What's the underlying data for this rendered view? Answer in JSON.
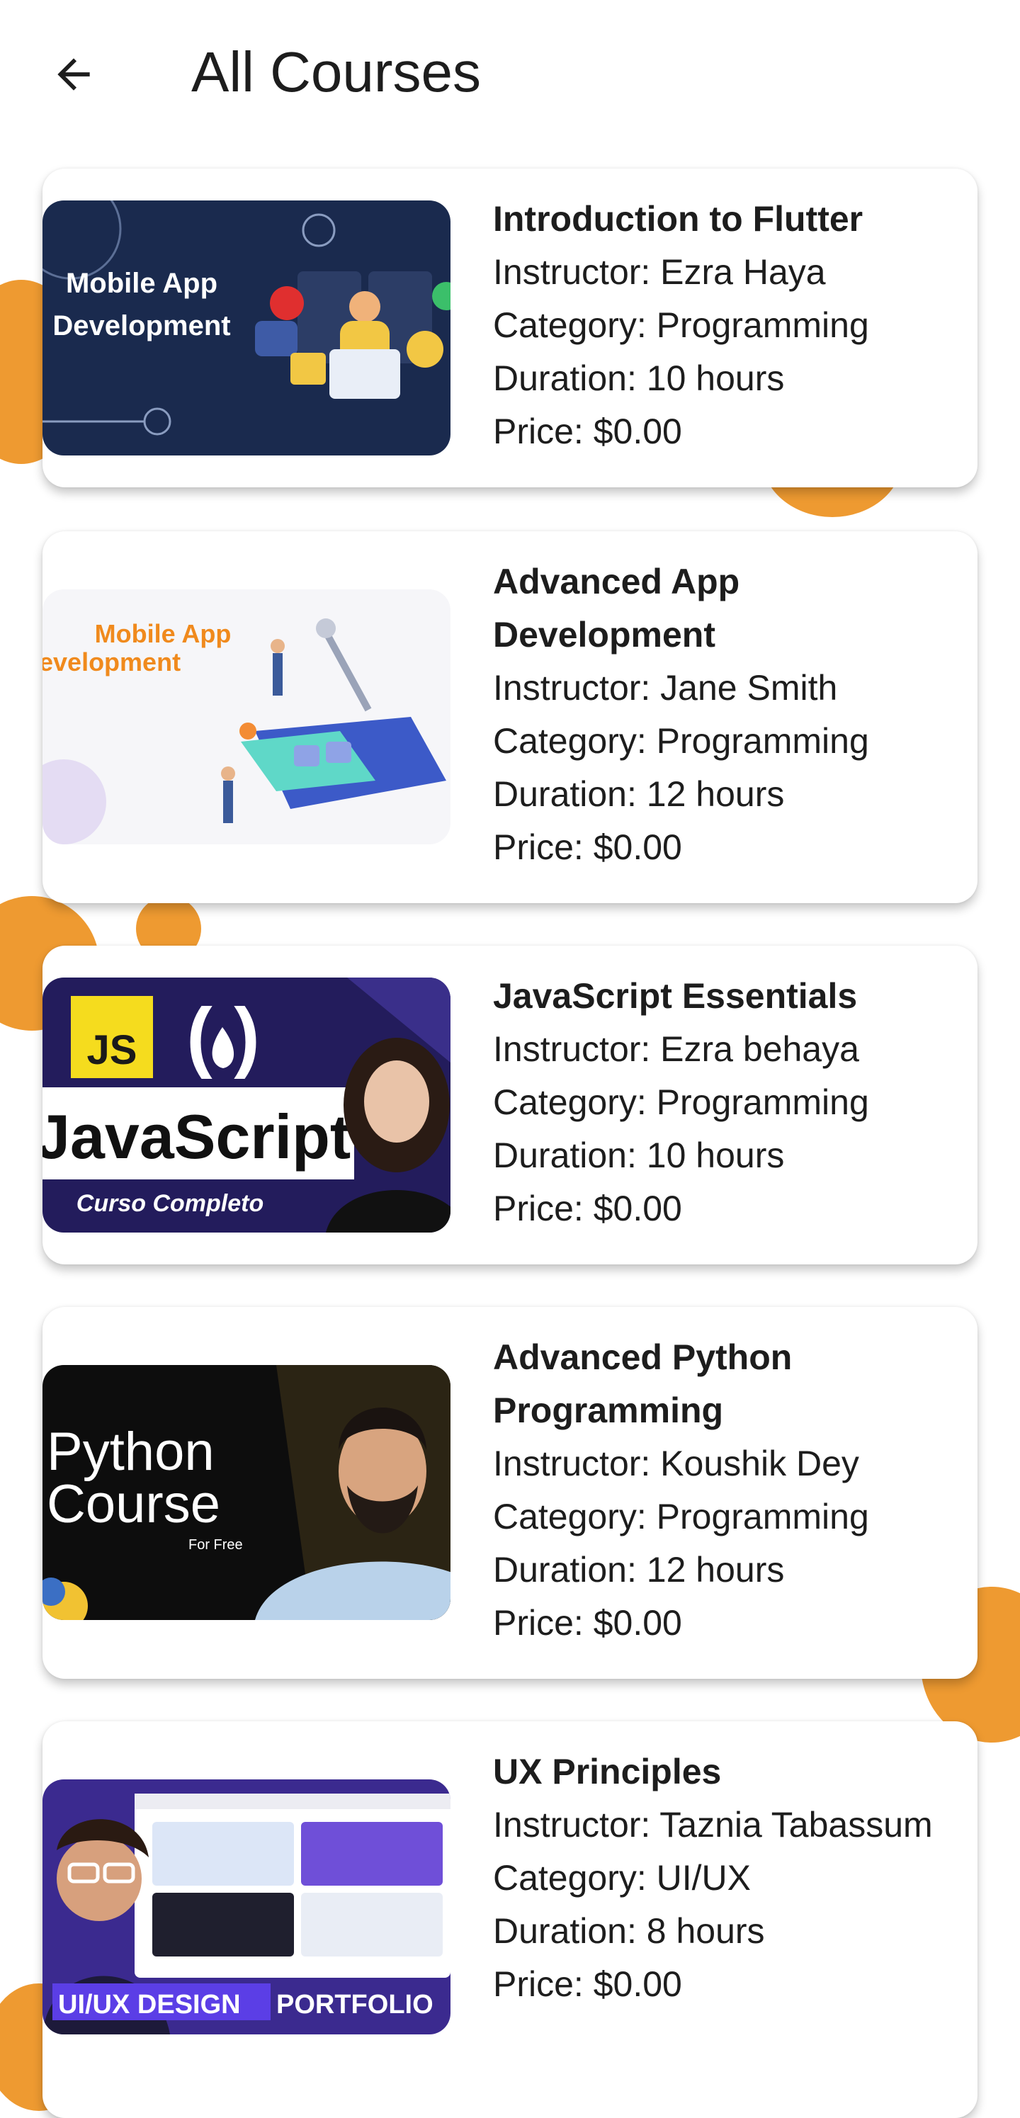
{
  "appbar": {
    "title": "All Courses",
    "back_icon": "arrow-left-icon"
  },
  "courses": [
    {
      "title": "Introduction to Flutter",
      "instructor": "Instructor: Ezra Haya",
      "category": "Category: Programming",
      "duration": "Duration: 10 hours",
      "price": "Price: $0.00",
      "thumb_text": [
        "Mobile App",
        "Development"
      ]
    },
    {
      "title": "Advanced App Development",
      "instructor": "Instructor: Jane Smith",
      "category": "Category: Programming",
      "duration": "Duration: 12 hours",
      "price": "Price: $0.00",
      "thumb_text": [
        "Mobile App",
        "evelopment"
      ]
    },
    {
      "title": "JavaScript Essentials",
      "instructor": "Instructor: Ezra behaya",
      "category": "Category: Programming",
      "duration": "Duration: 10 hours",
      "price": "Price: $0.00",
      "thumb_text": [
        "JS",
        "JavaScript",
        "Curso Completo"
      ]
    },
    {
      "title": "Advanced Python Programming",
      "instructor": "Instructor: Koushik Dey",
      "category": "Category: Programming",
      "duration": "Duration: 12 hours",
      "price": "Price: $0.00",
      "thumb_text": [
        "Python",
        "Course",
        "For Free"
      ]
    },
    {
      "title": "UX Principles",
      "instructor": "Instructor: Taznia Tabassum",
      "category": "Category: UI/UX",
      "duration": "Duration: 8 hours",
      "price": "Price: $0.00",
      "thumb_text": [
        "UI/UX DESIGN",
        "PORTFOLIO"
      ]
    }
  ],
  "colors": {
    "accent_orange": "#ee9a31",
    "card_bg": "#ffffff",
    "text": "#1d1d1d"
  }
}
